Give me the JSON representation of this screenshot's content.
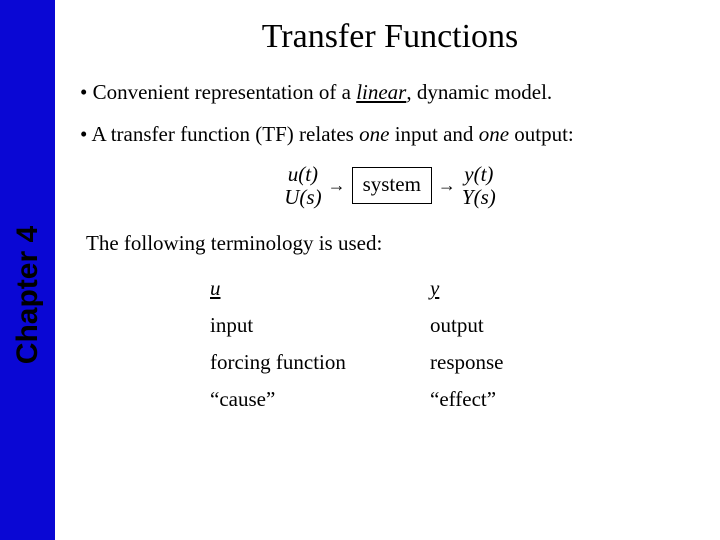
{
  "sidebar": {
    "label": "Chapter 4"
  },
  "title": "Transfer Functions",
  "bullets": {
    "b1_prefix": "• Convenient representation of a ",
    "b1_emph": "linear",
    "b1_suffix": ", dynamic model.",
    "b2_prefix": "• A transfer function (TF) relates ",
    "b2_one1": "one",
    "b2_mid": " input and ",
    "b2_one2": "one",
    "b2_suffix": " output:"
  },
  "diagram": {
    "u_t": "u(t)",
    "U_s": "U(s)",
    "arrow": "→",
    "system": "system",
    "y_t": "y(t)",
    "Y_s": "Y(s)"
  },
  "terminology_line": "The following terminology is used:",
  "terms": {
    "head_u": "u",
    "head_y": "y",
    "rows": [
      {
        "u": "input",
        "y": "output"
      },
      {
        "u": "forcing function",
        "y": "response"
      },
      {
        "u": "“cause”",
        "y": "“effect”"
      }
    ]
  }
}
